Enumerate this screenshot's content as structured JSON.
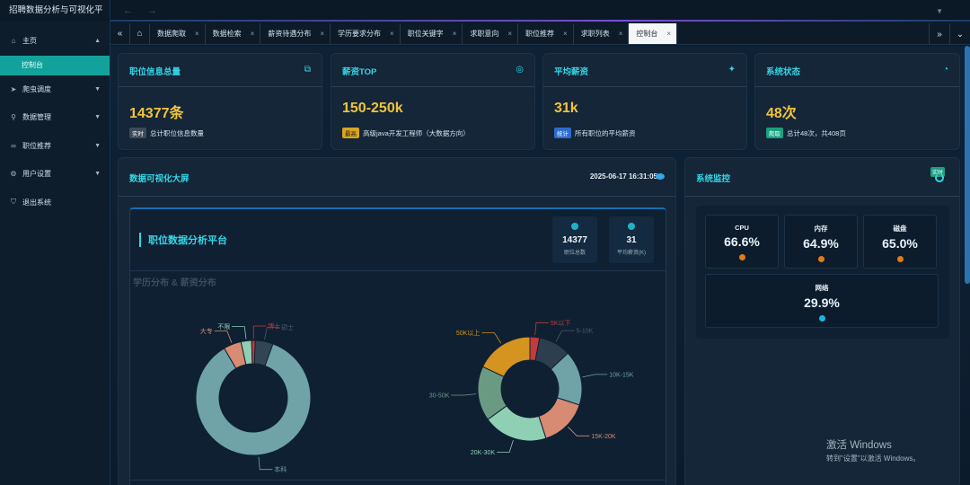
{
  "app": {
    "title": "招聘数据分析与可视化平"
  },
  "sidebar": {
    "items": [
      {
        "label": "主页",
        "icon": "home-icon",
        "expanded": true
      },
      {
        "label": "爬虫调度",
        "icon": "send-icon"
      },
      {
        "label": "数据管理",
        "icon": "search-icon"
      },
      {
        "label": "职位推荐",
        "icon": "link-icon"
      },
      {
        "label": "用户设置",
        "icon": "gear-icon"
      },
      {
        "label": "退出系统",
        "icon": "shield-icon"
      }
    ],
    "active_sub": "控制台"
  },
  "tabs": [
    {
      "label": "数据爬取"
    },
    {
      "label": "数据检索"
    },
    {
      "label": "薪资待遇分布"
    },
    {
      "label": "学历要求分布"
    },
    {
      "label": "职位关键字"
    },
    {
      "label": "求职意向"
    },
    {
      "label": "职位推荐"
    },
    {
      "label": "求职列表"
    },
    {
      "label": "控制台",
      "active": true
    }
  ],
  "cards": {
    "total": {
      "title": "职位信息总量",
      "value": "14377条",
      "badge": "实时",
      "desc": "总计职位信息数量"
    },
    "top": {
      "title": "薪资TOP",
      "value": "150-250k",
      "badge": "最高",
      "desc": "高级java开发工程师（大数据方向）"
    },
    "avg": {
      "title": "平均薪资",
      "value": "31k",
      "badge": "统计",
      "desc": "所有职位的平均薪资"
    },
    "status": {
      "title": "系统状态",
      "value": "48次",
      "badge": "爬取",
      "desc": "总计48次，共408页"
    }
  },
  "bigscreen": {
    "title": "数据可视化大屏",
    "date": "2025-06-17 16:31:05",
    "platform_title": "职位数据分析平台",
    "stats": [
      {
        "value": "14377",
        "label": "职位总数"
      },
      {
        "value": "31",
        "label": "平均薪资(K)"
      }
    ],
    "chart_section_title": "学历分布 & 薪资分布"
  },
  "chart_data": [
    {
      "type": "pie",
      "categories": [
        "本科",
        "大专",
        "不限",
        "博士",
        "硕士"
      ],
      "values": [
        86,
        5,
        3,
        1,
        5
      ],
      "colors": [
        "#6fa3a8",
        "#d68b72",
        "#8fcfb4",
        "#c23b3b",
        "#324555"
      ]
    },
    {
      "type": "pie",
      "categories": [
        "5K以下",
        "5-10K",
        "10K-15K",
        "15K-20K",
        "20K-30K",
        "30-50K",
        "50K以上"
      ],
      "values": [
        3,
        10,
        17,
        15,
        20,
        17,
        18
      ],
      "colors": [
        "#c23b3b",
        "#2d3e4f",
        "#6fa3a8",
        "#d68b72",
        "#8fcfb4",
        "#6b9a83",
        "#d4941f"
      ]
    }
  ],
  "monitor": {
    "title": "系统监控",
    "live_badge": "实时",
    "metrics": [
      {
        "label": "CPU",
        "value": "66.6%",
        "color": "#e07b16"
      },
      {
        "label": "内存",
        "value": "64.9%",
        "color": "#e07b16"
      },
      {
        "label": "磁盘",
        "value": "65.0%",
        "color": "#e07b16"
      },
      {
        "label": "网络",
        "value": "29.9%",
        "color": "#19b7e0"
      }
    ]
  },
  "watermark": {
    "line1": "激活 Windows",
    "line2": "转到\"设置\"以激活 Windows。"
  }
}
